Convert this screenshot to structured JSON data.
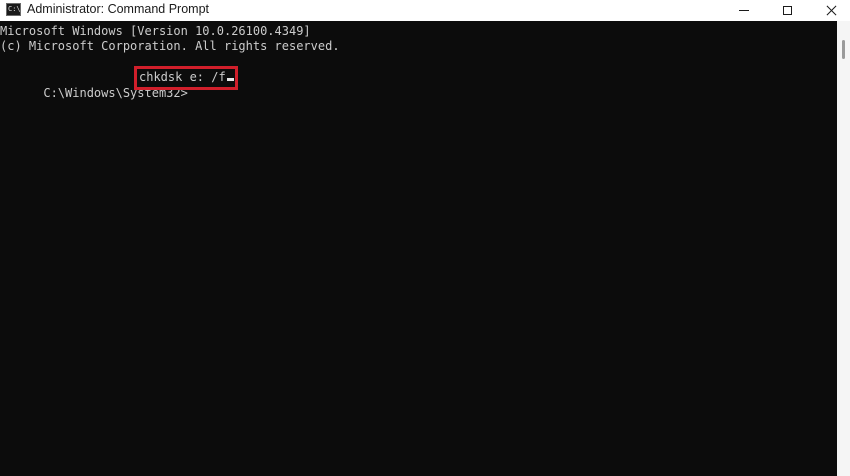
{
  "window": {
    "title": "Administrator: Command Prompt",
    "icon": "cmd-icon",
    "icon_glyph": "C:\\"
  },
  "terminal": {
    "line1": "Microsoft Windows [Version 10.0.26100.4349]",
    "line2": "(c) Microsoft Corporation. All rights reserved.",
    "prompt": "C:\\Windows\\System32>",
    "command": "chkdsk e: /f"
  },
  "colors": {
    "terminal_bg": "#0c0c0c",
    "terminal_text": "#cccccc",
    "highlight_box": "#d11f2b",
    "titlebar_bg": "#ffffff"
  }
}
